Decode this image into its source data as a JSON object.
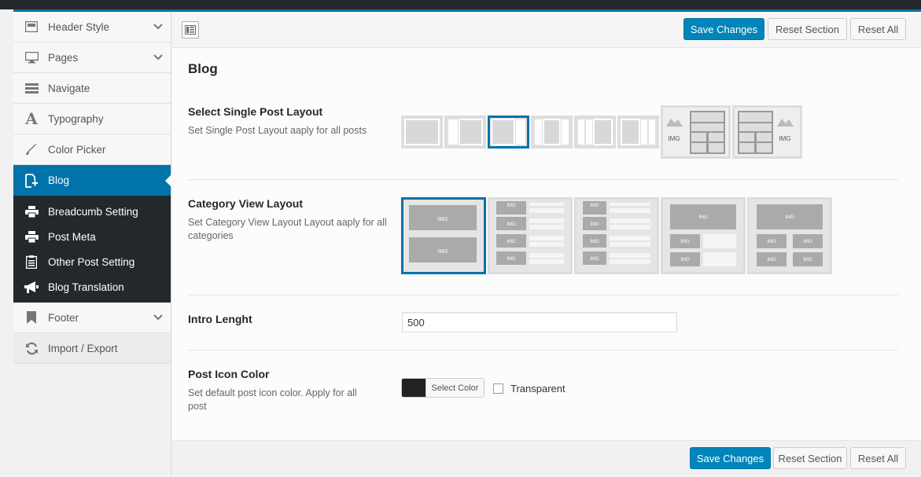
{
  "sidebar": {
    "items": [
      {
        "label": "Header Style",
        "icon": "layout-icon",
        "has_chevron": true
      },
      {
        "label": "Pages",
        "icon": "desktop-icon",
        "has_chevron": true
      },
      {
        "label": "Navigate",
        "icon": "menu-icon",
        "has_chevron": false
      },
      {
        "label": "Typography",
        "icon": "typography-icon",
        "has_chevron": false
      },
      {
        "label": "Color Picker",
        "icon": "brush-icon",
        "has_chevron": false
      },
      {
        "label": "Blog",
        "icon": "add-page-icon",
        "active": true
      }
    ],
    "blog_sub": [
      {
        "label": "Breadcumb Setting",
        "icon": "printer-icon"
      },
      {
        "label": "Post Meta",
        "icon": "printer-icon"
      },
      {
        "label": "Other Post Setting",
        "icon": "clipboard-icon"
      },
      {
        "label": "Blog Translation",
        "icon": "megaphone-icon"
      }
    ],
    "footer": {
      "label": "Footer",
      "icon": "bookmark-icon"
    },
    "import_export": {
      "label": "Import / Export",
      "icon": "refresh-icon"
    }
  },
  "toolbar": {
    "save_label": "Save Changes",
    "reset_section_label": "Reset Section",
    "reset_all_label": "Reset All"
  },
  "section": {
    "title": "Blog"
  },
  "single_post_layout": {
    "title": "Select Single Post Layout",
    "desc": "Set Single Post Layout aaply for all posts",
    "selected_index": 2,
    "img_label": "IMG"
  },
  "category_layout": {
    "title": "Category View Layout",
    "desc": "Set Category View Layout Layout aaply for all categories",
    "selected_index": 0,
    "img_label": "IMG"
  },
  "intro_length": {
    "title": "Intro Lenght",
    "value": "500"
  },
  "post_icon_color": {
    "title": "Post Icon Color",
    "desc": "Set default post icon color. Apply for all post",
    "button_label": "Select Color",
    "color": "#222222",
    "transparent_label": "Transparent",
    "transparent_checked": false
  },
  "colors": {
    "accent": "#0073aa",
    "primary_button": "#0085ba",
    "sidebar_dark": "#23282d"
  }
}
